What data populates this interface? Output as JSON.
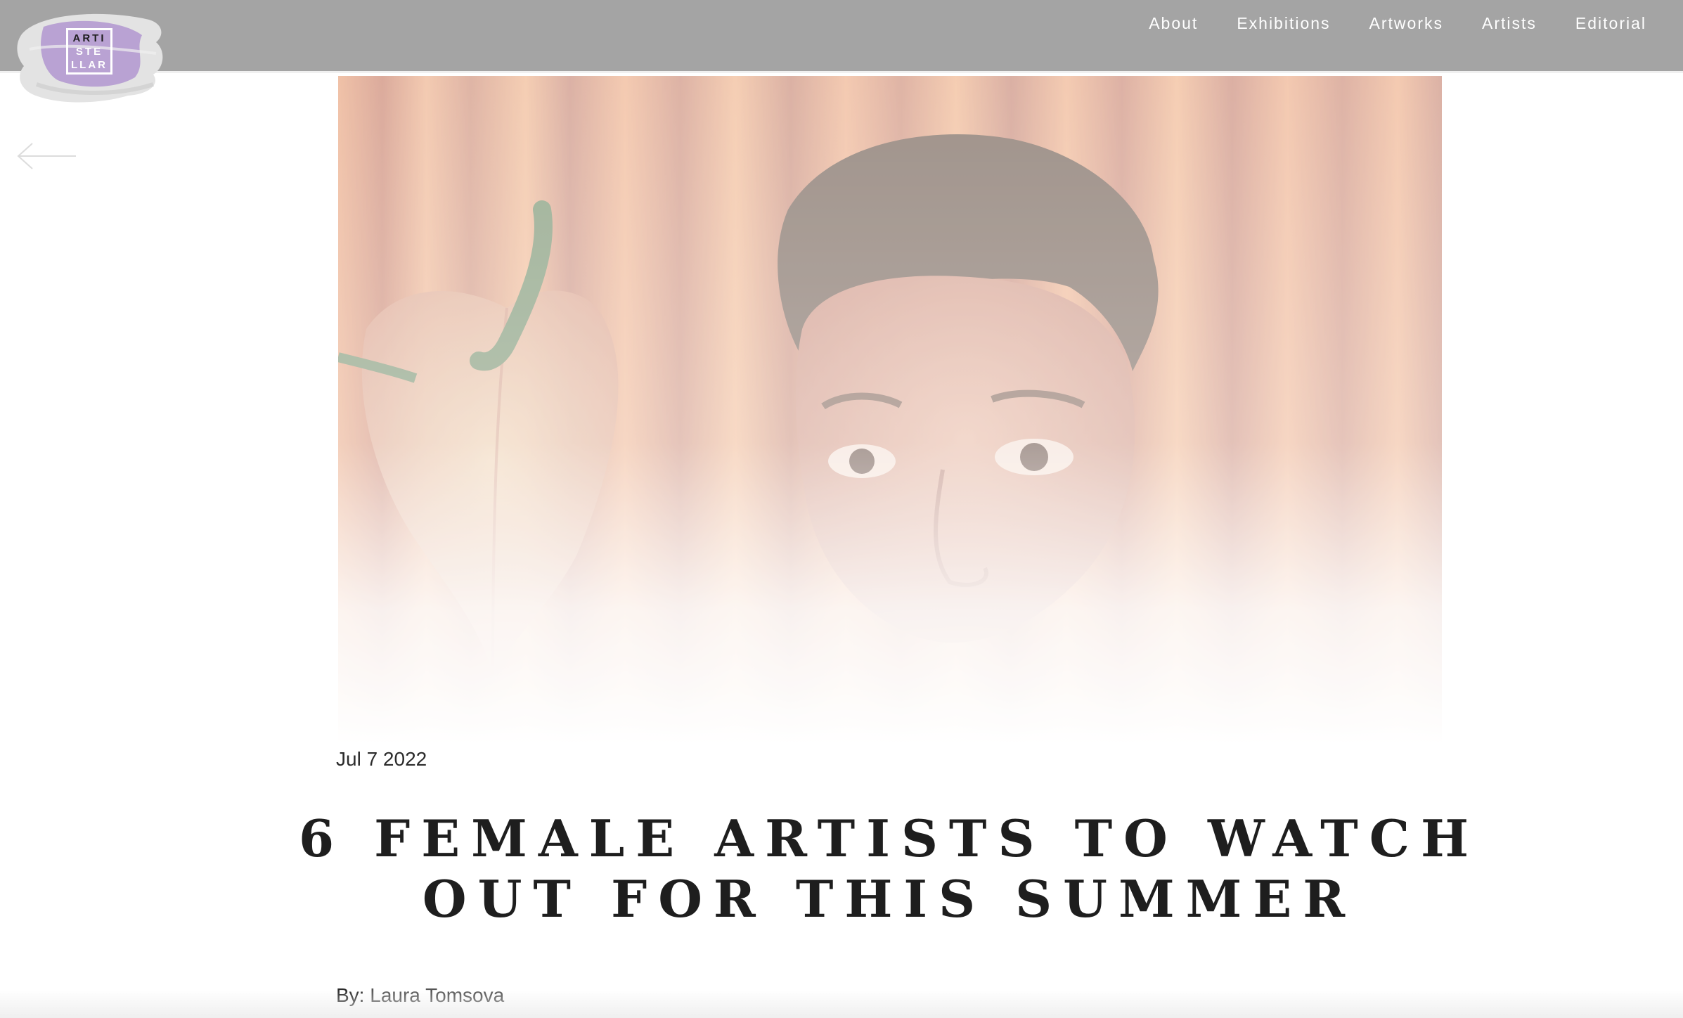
{
  "logo": {
    "line1": "ARTI",
    "line2": "STE",
    "line3": "LLAR",
    "brush_color": "#b49ad0"
  },
  "nav": {
    "items": [
      "About",
      "Exhibitions",
      "Artworks",
      "Artists",
      "Editorial"
    ]
  },
  "back_button": {
    "icon": "arrow-left-icon"
  },
  "hero_image": {
    "subject": "painting"
  },
  "article": {
    "date": "Jul 7 2022",
    "title": "6 FEMALE ARTISTS TO WATCH OUT FOR THIS SUMMER",
    "byline_prefix": "By:",
    "author": "Laura Tomsova"
  },
  "colors": {
    "header_bg": "#a4a4a4",
    "text_dark": "#1e1e1e",
    "stripe_warm": "#e89a6a"
  }
}
